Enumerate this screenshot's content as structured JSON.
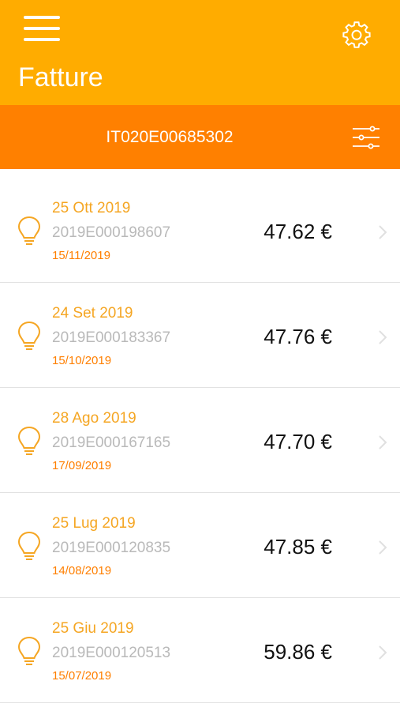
{
  "header": {
    "title": "Fatture",
    "menu_icon": "hamburger-menu-icon",
    "settings_icon": "gear-icon",
    "bg_color": "#FFAC00"
  },
  "account": {
    "code": "IT020E00685302",
    "filter_icon": "sliders-icon",
    "bg_color": "#FF8000"
  },
  "invoices": [
    {
      "date": "25 Ott 2019",
      "number": "2019E000198607",
      "due": "15/11/2019",
      "amount": "47.62 €"
    },
    {
      "date": "24 Set 2019",
      "number": "2019E000183367",
      "due": "15/10/2019",
      "amount": "47.76 €"
    },
    {
      "date": "28 Ago 2019",
      "number": "2019E000167165",
      "due": "17/09/2019",
      "amount": "47.70 €"
    },
    {
      "date": "25 Lug 2019",
      "number": "2019E000120835",
      "due": "14/08/2019",
      "amount": "47.85 €"
    },
    {
      "date": "25 Giu 2019",
      "number": "2019E000120513",
      "due": "15/07/2019",
      "amount": "59.86 €"
    }
  ],
  "colors": {
    "date": "#F5A623",
    "due": "#FF7F00",
    "number": "#B9B9B9",
    "icon": "#F5A623"
  }
}
